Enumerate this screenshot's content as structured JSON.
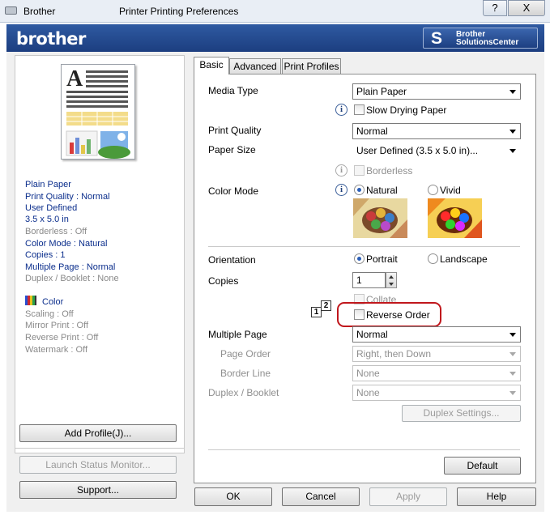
{
  "window": {
    "title_app": "Brother",
    "title": "Printer Printing Preferences",
    "help_btn": "?",
    "close_btn": "X"
  },
  "banner": {
    "brand": "brother",
    "solutions_line1": "Brother",
    "solutions_line2": "SolutionsCenter"
  },
  "summary": {
    "items": [
      "Plain Paper",
      "Print Quality : Normal",
      "User Defined",
      "3.5 x 5.0 in",
      "Borderless : Off",
      "Color Mode : Natural",
      "Copies : 1",
      "Multiple Page : Normal",
      "Duplex / Booklet : None"
    ],
    "color_label": "Color",
    "items2": [
      "Scaling : Off",
      "Mirror Print : Off",
      "Reverse Print : Off",
      "Watermark : Off"
    ]
  },
  "left_buttons": {
    "add_profile": "Add Profile(J)...",
    "launch_status": "Launch Status Monitor...",
    "support": "Support..."
  },
  "tabs": [
    "Basic",
    "Advanced",
    "Print Profiles"
  ],
  "basic": {
    "media_type_label": "Media Type",
    "media_type_value": "Plain Paper",
    "slow_drying": "Slow Drying Paper",
    "print_quality_label": "Print Quality",
    "print_quality_value": "Normal",
    "paper_size_label": "Paper Size",
    "paper_size_value": "User Defined (3.5 x 5.0 in)...",
    "borderless": "Borderless",
    "color_mode_label": "Color Mode",
    "natural": "Natural",
    "vivid": "Vivid",
    "orientation_label": "Orientation",
    "portrait": "Portrait",
    "landscape": "Landscape",
    "copies_label": "Copies",
    "copies_value": "1",
    "collate": "Collate",
    "reverse_order": "Reverse Order",
    "order_icon_1": "1",
    "order_icon_2": "2",
    "multiple_page_label": "Multiple Page",
    "multiple_page_value": "Normal",
    "page_order_label": "Page Order",
    "page_order_value": "Right, then Down",
    "border_line_label": "Border Line",
    "border_line_value": "None",
    "duplex_label": "Duplex / Booklet",
    "duplex_value": "None",
    "duplex_settings": "Duplex Settings...",
    "default_btn": "Default",
    "info_glyph": "i"
  },
  "footer": {
    "ok": "OK",
    "cancel": "Cancel",
    "apply": "Apply",
    "help": "Help"
  },
  "colors": {
    "brand_blue": "#1f4388",
    "highlight": "#c0171c"
  }
}
